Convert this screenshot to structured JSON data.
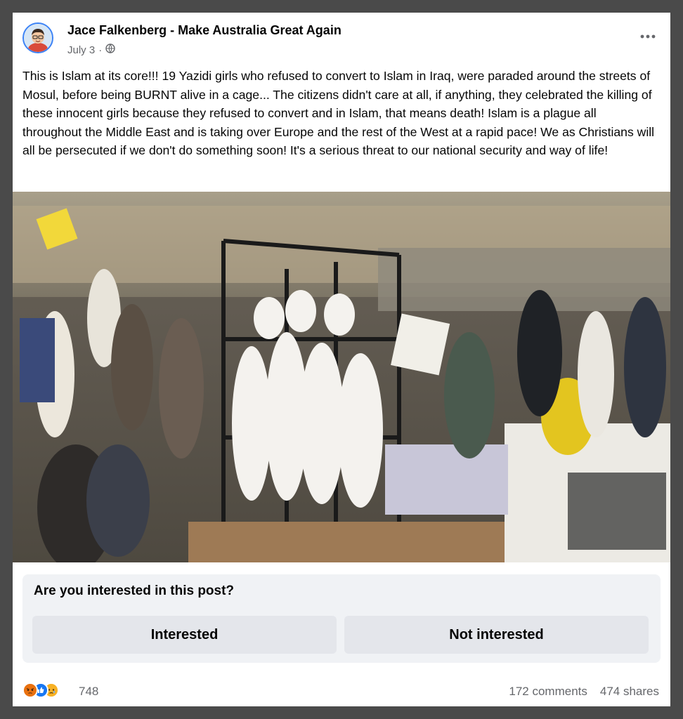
{
  "post": {
    "author": "Jace Falkenberg - Make Australia Great Again",
    "date": "July 3",
    "separator": "·",
    "privacy_icon": "globe-icon",
    "more_icon": "more-horizontal-icon",
    "text": "This is Islam at its core!!! 19 Yazidi girls who refused to convert to Islam in Iraq, were paraded around the streets of Mosul, before being BURNT alive in a cage... The citizens didn't care at all, if anything, they celebrated the killing of these innocent girls because they refused to convert and in Islam, that means death! Islam is a plague all throughout the Middle East and is taking over Europe and the rest of the West at a rapid pace! We as Christians will all be persecuted if we don't do something soon! It's a serious threat to our national security and way of life!"
  },
  "survey": {
    "question": "Are you interested in this post?",
    "interested_label": "Interested",
    "not_interested_label": "Not interested"
  },
  "footer": {
    "reaction_icons": [
      "angry-reaction-icon",
      "like-reaction-icon",
      "sad-reaction-icon"
    ],
    "reaction_count": "748",
    "comments": "172 comments",
    "shares": "474 shares"
  },
  "colors": {
    "text": "#050505",
    "secondary_text": "#65676b",
    "survey_bg": "#f0f2f5",
    "button_bg": "#e4e6eb",
    "like_blue": "#1877f2",
    "angry_orange": "#e9710f",
    "sad_yellow": "#f7b125"
  }
}
